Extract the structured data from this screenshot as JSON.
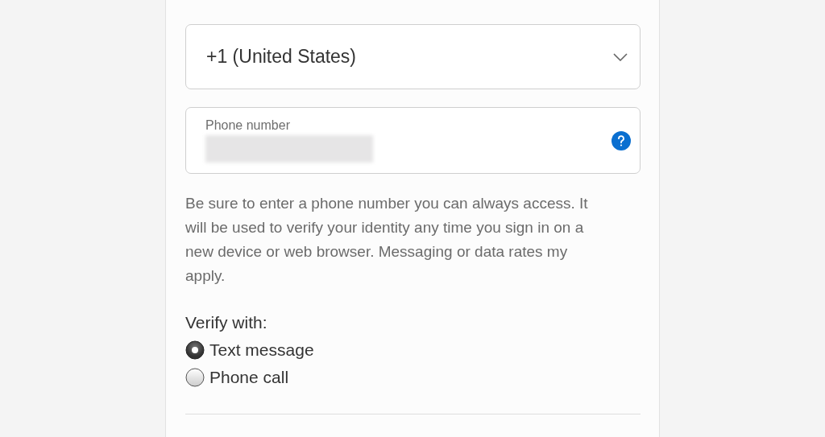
{
  "country_select": {
    "value": "+1 (United States)"
  },
  "phone_field": {
    "label": "Phone number",
    "redacted": true
  },
  "help_text": "Be sure to enter a phone number you can always access. It will be used to verify your identity any time you sign in on a new device or web browser. Messaging or data rates my apply.",
  "verify": {
    "label": "Verify with:",
    "options": [
      {
        "label": "Text message",
        "selected": true
      },
      {
        "label": "Phone call",
        "selected": false
      }
    ]
  }
}
